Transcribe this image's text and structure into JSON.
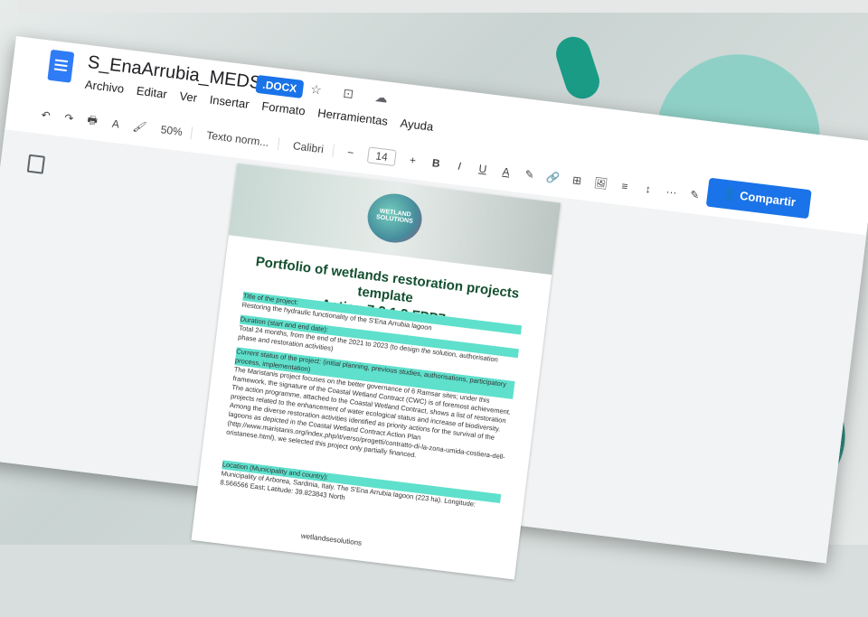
{
  "app": {
    "file_name": "S_EnaArrubia_MEDSEA",
    "badge": ".DOCX",
    "title_icons": "☆ ⊡ ☁"
  },
  "menu": [
    "Archivo",
    "Editar",
    "Ver",
    "Insertar",
    "Formato",
    "Herramientas",
    "Ayuda"
  ],
  "toolbar": {
    "undo": "↶",
    "redo": "↷",
    "print": "🖶",
    "spell": "A",
    "paint": "🖌",
    "zoom": "50%",
    "style": "Texto norm...",
    "font": "Calibri",
    "minus": "−",
    "font_size": "14",
    "plus": "+",
    "bold": "B",
    "italic": "I",
    "underline": "U",
    "text_color": "A",
    "highlight": "✎",
    "link": "🔗",
    "comment": "⊞",
    "image": "🖼",
    "align": "≡",
    "line_spacing": "↕",
    "more": "···",
    "edit": "✎",
    "collapse": "∧"
  },
  "share_label": "Compartir",
  "comments_icon": "▤",
  "document": {
    "logo_text": "WETLAND SOLUTIONS",
    "title_line1": "Portfolio of wetlands restoration projects template",
    "title_line2": "Action 7.2.1.3 FPP7",
    "s1_head": "Title of the project:",
    "s1_body": "Restoring the hydraulic functionality of the S'Ena Arrubia lagoon",
    "s2_head": "Duration (start and end date):",
    "s2_body": "Total 24 months, from the end of the 2021 to 2023 (to design the solution, authorisation phase and restoration activities)",
    "s3_head": "Current status of the project: (initial planning, previous studies, authorisations, participatory process, implementation)",
    "s3_body": "The Maristanis project focuses on the better governance of 6 Ramsar sites; under this framework, the signature of the Coastal Wetland Contract (CWC) is of foremost achievement. The action programme, attached to the Coastal Wetland Contract, shows a list of restoration projects related to the enhancement of water ecological status and increase of biodiversity. Among the diverse restoration activities identified as priority actions for the survival of the lagoons as depicted in the Coastal Wetland Contract Action Plan (http://www.maristanis.org/index.php/it/verso/progetti/contratto-di-la-zona-umida-costiera-dell-oristanese.html), we selected this project only partially financed.",
    "s4_head": "Location (Municipality and country):",
    "s4_body": "Municipality of Arborea, Sardinia, Italy. The S'Ena Arrubia lagoon (223 ha). Longitude: 8.566566 East; Latitude: 39.823843 North",
    "footer": "wetlandsesolutions"
  }
}
